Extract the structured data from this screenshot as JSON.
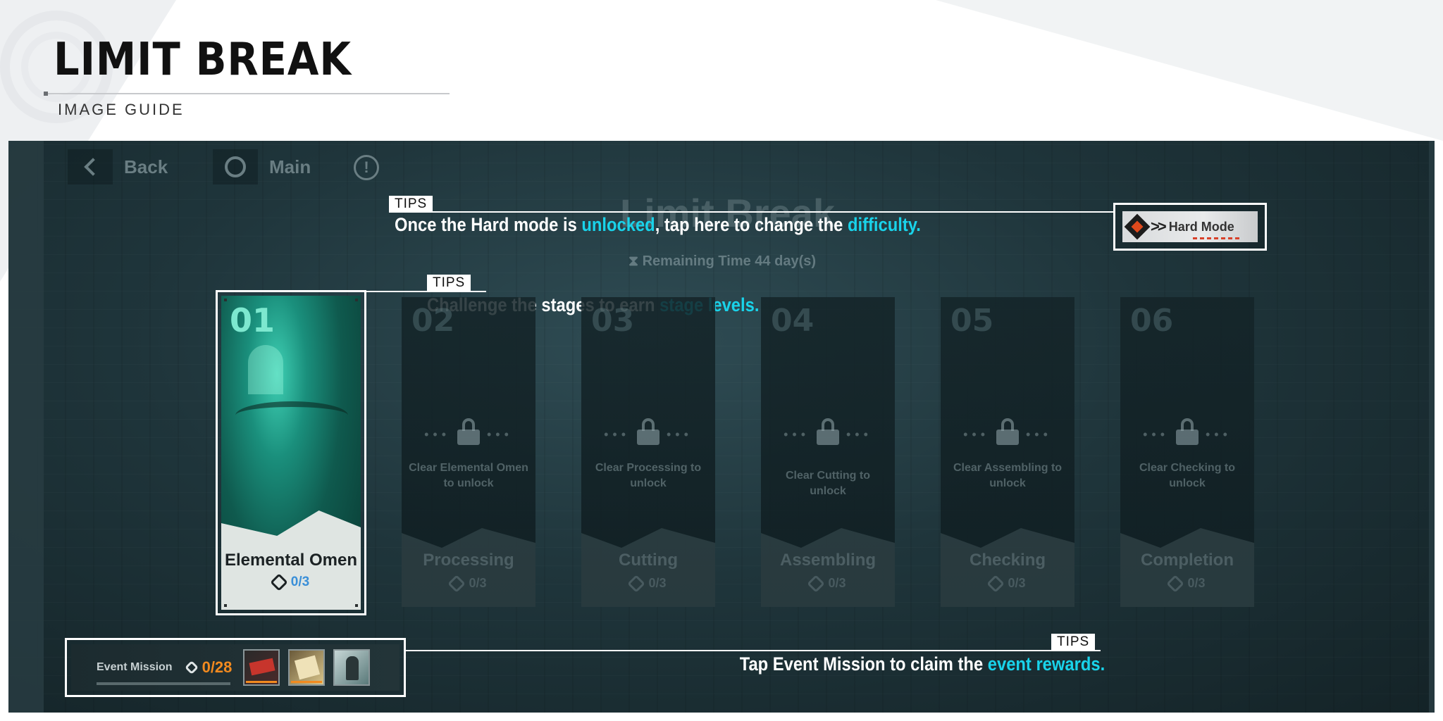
{
  "header": {
    "title": "LIMIT BREAK",
    "subtitle": "IMAGE GUIDE"
  },
  "nav": {
    "back_label": "Back",
    "main_label": "Main",
    "info_glyph": "!"
  },
  "game": {
    "title": "Limit Break",
    "remaining_time_label": "Remaining Time",
    "remaining_time_value": "44 day(s)",
    "hourglass_glyph": "⧗"
  },
  "hard_mode": {
    "label": "Hard Mode",
    "arrows": ">>"
  },
  "tips": [
    {
      "tag": "TIPS",
      "text_before": "Once the Hard mode is ",
      "highlight_1": "unlocked",
      "text_middle": ", tap here to change the ",
      "highlight_2": "difficulty."
    },
    {
      "tag": "TIPS",
      "text_before": "Challenge the stages to earn ",
      "highlight_1": "stage levels."
    },
    {
      "tag": "TIPS",
      "text_before": "Tap Event Mission to claim the ",
      "highlight_1": "event rewards."
    }
  ],
  "stages": [
    {
      "num": "01",
      "name": "Elemental Omen",
      "progress": "0/3",
      "locked": false,
      "unlock_text": ""
    },
    {
      "num": "02",
      "name": "Processing",
      "progress": "0/3",
      "locked": true,
      "unlock_text": "Clear Elemental Omen to unlock"
    },
    {
      "num": "03",
      "name": "Cutting",
      "progress": "0/3",
      "locked": true,
      "unlock_text": "Clear Processing to unlock"
    },
    {
      "num": "04",
      "name": "Assembling",
      "progress": "0/3",
      "locked": true,
      "unlock_text": "Clear Cutting to unlock"
    },
    {
      "num": "05",
      "name": "Checking",
      "progress": "0/3",
      "locked": true,
      "unlock_text": "Clear Assembling to unlock"
    },
    {
      "num": "06",
      "name": "Completion",
      "progress": "0/3",
      "locked": true,
      "unlock_text": "Clear Checking to unlock"
    }
  ],
  "event_mission": {
    "label": "Event Mission",
    "count": "0/28"
  },
  "colors": {
    "highlight": "#19d3ea",
    "event_count": "#f28a1f",
    "progress_active": "#3a8fd8"
  }
}
